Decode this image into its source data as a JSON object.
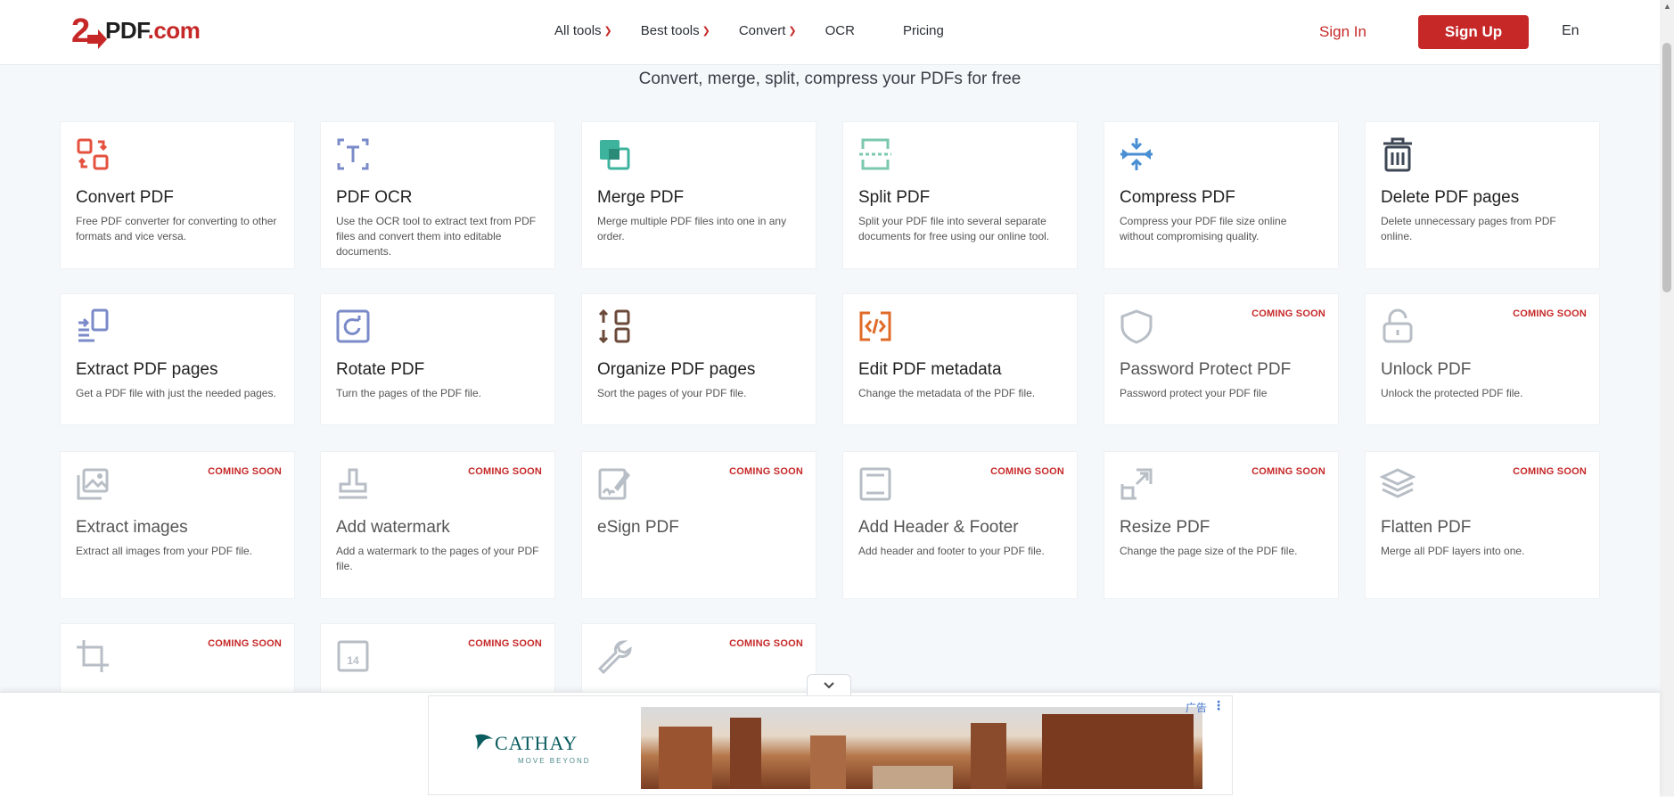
{
  "header": {
    "logo_prefix": "2",
    "logo_main": "PDF",
    "logo_suffix": ".com",
    "nav": [
      {
        "label": "All tools",
        "dropdown": true
      },
      {
        "label": "Best tools",
        "dropdown": true
      },
      {
        "label": "Convert",
        "dropdown": true
      },
      {
        "label": "OCR",
        "dropdown": false
      },
      {
        "label": "Pricing",
        "dropdown": false
      }
    ],
    "sign_in": "Sign In",
    "sign_up": "Sign Up",
    "language": "En"
  },
  "subtitle": "Convert, merge, split, compress your PDFs for free",
  "tools": [
    {
      "title": "Convert PDF",
      "desc": "Free PDF converter for converting to other formats and vice versa.",
      "icon": "convert-icon",
      "color": "#e4513f",
      "badge": ""
    },
    {
      "title": "PDF OCR",
      "desc": "Use the OCR tool to extract text from PDF files and convert them into editable documents.",
      "icon": "ocr-icon",
      "color": "#7b8bc9",
      "badge": ""
    },
    {
      "title": "Merge PDF",
      "desc": "Merge multiple PDF files into one in any order.",
      "icon": "merge-icon",
      "color": "#3db39e",
      "badge": ""
    },
    {
      "title": "Split PDF",
      "desc": "Split your PDF file into several separate documents for free using our online tool.",
      "icon": "split-icon",
      "color": "#7bc8ae",
      "badge": ""
    },
    {
      "title": "Compress PDF",
      "desc": "Compress your PDF file size online without compromising quality.",
      "icon": "compress-icon",
      "color": "#4a8fd4",
      "badge": ""
    },
    {
      "title": "Delete PDF pages",
      "desc": "Delete unnecessary pages from PDF online.",
      "icon": "trash-icon",
      "color": "#3e4756",
      "badge": ""
    },
    {
      "title": "Extract PDF pages",
      "desc": "Get a PDF file with just the needed pages.",
      "icon": "extract-icon",
      "color": "#7b8bc9",
      "badge": ""
    },
    {
      "title": "Rotate PDF",
      "desc": "Turn the pages of the PDF file.",
      "icon": "rotate-icon",
      "color": "#7b8bc9",
      "badge": ""
    },
    {
      "title": "Organize PDF pages",
      "desc": "Sort the pages of your PDF file.",
      "icon": "organize-icon",
      "color": "#6b4a3a",
      "badge": ""
    },
    {
      "title": "Edit PDF metadata",
      "desc": "Change the metadata of the PDF file.",
      "icon": "code-icon",
      "color": "#e06b28",
      "badge": ""
    },
    {
      "title": "Password Protect PDF",
      "desc": "Password protect your PDF file",
      "icon": "shield-icon",
      "color": "#b8bec6",
      "badge": "COMING SOON"
    },
    {
      "title": "Unlock PDF",
      "desc": "Unlock the protected PDF file.",
      "icon": "unlock-icon",
      "color": "#b8bec6",
      "badge": "COMING SOON"
    },
    {
      "title": "Extract images",
      "desc": "Extract all images from your PDF file.",
      "icon": "image-icon",
      "color": "#b8bec6",
      "badge": "COMING SOON"
    },
    {
      "title": "Add watermark",
      "desc": "Add a watermark to the pages of your PDF file.",
      "icon": "stamp-icon",
      "color": "#b8bec6",
      "badge": "COMING SOON"
    },
    {
      "title": "eSign PDF",
      "desc": "",
      "icon": "sign-icon",
      "color": "#b8bec6",
      "badge": "COMING SOON"
    },
    {
      "title": "Add Header & Footer",
      "desc": "Add header and footer to your PDF file.",
      "icon": "header-footer-icon",
      "color": "#b8bec6",
      "badge": "COMING SOON"
    },
    {
      "title": "Resize PDF",
      "desc": "Change the page size of the PDF file.",
      "icon": "resize-icon",
      "color": "#b8bec6",
      "badge": "COMING SOON"
    },
    {
      "title": "Flatten PDF",
      "desc": "Merge all PDF layers into one.",
      "icon": "layers-icon",
      "color": "#b8bec6",
      "badge": "COMING SOON"
    },
    {
      "title": "",
      "desc": "",
      "icon": "crop-icon",
      "color": "#b8bec6",
      "badge": "COMING SOON"
    },
    {
      "title": "",
      "desc": "",
      "icon": "page-number-icon",
      "color": "#b8bec6",
      "badge": "COMING SOON"
    },
    {
      "title": "",
      "desc": "",
      "icon": "wrench-icon",
      "color": "#b8bec6",
      "badge": "COMING SOON"
    }
  ],
  "page_number_icon_text": "14",
  "ad": {
    "brand": "CATHAY",
    "tagline": "MOVE BEYOND",
    "label": "广告"
  }
}
